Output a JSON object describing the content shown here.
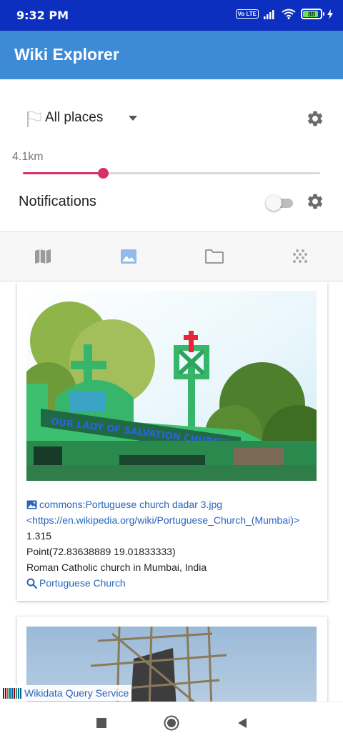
{
  "status_bar": {
    "time": "9:32 PM",
    "network_badge": "Vo LTE",
    "battery_percent": "88",
    "battery_level": 0.88
  },
  "app_bar": {
    "title": "Wiki Explorer"
  },
  "filter": {
    "place_filter": "All places",
    "distance_label": "4.1km",
    "distance_fraction": 0.27
  },
  "notifications": {
    "label": "Notifications",
    "enabled": false
  },
  "tabs": [
    {
      "name": "map",
      "icon": "map-icon",
      "active": false
    },
    {
      "name": "images",
      "icon": "image-icon",
      "active": true
    },
    {
      "name": "folder",
      "icon": "folder-icon",
      "active": false
    },
    {
      "name": "dots",
      "icon": "dots-grid-icon",
      "active": false
    }
  ],
  "results": [
    {
      "commons_link": "commons:Portuguese church dadar 3.jpg",
      "wiki_url": "<https://en.wikipedia.org/wiki/Portuguese_Church_(Mumbai)>",
      "distance": "1.315",
      "point": "Point(72.83638889 19.01833333)",
      "description": "Roman Catholic church in Mumbai, India",
      "search_link": "Portuguese Church",
      "photo_sign": "OUR LADY OF SALVATION CHURCH"
    }
  ],
  "footer_badge": {
    "label": "Wikidata Query Service"
  },
  "colors": {
    "status_bar": "#0d2fbf",
    "app_bar": "#3d8ad6",
    "accent": "#d62f6b",
    "link": "#2a64bd"
  }
}
